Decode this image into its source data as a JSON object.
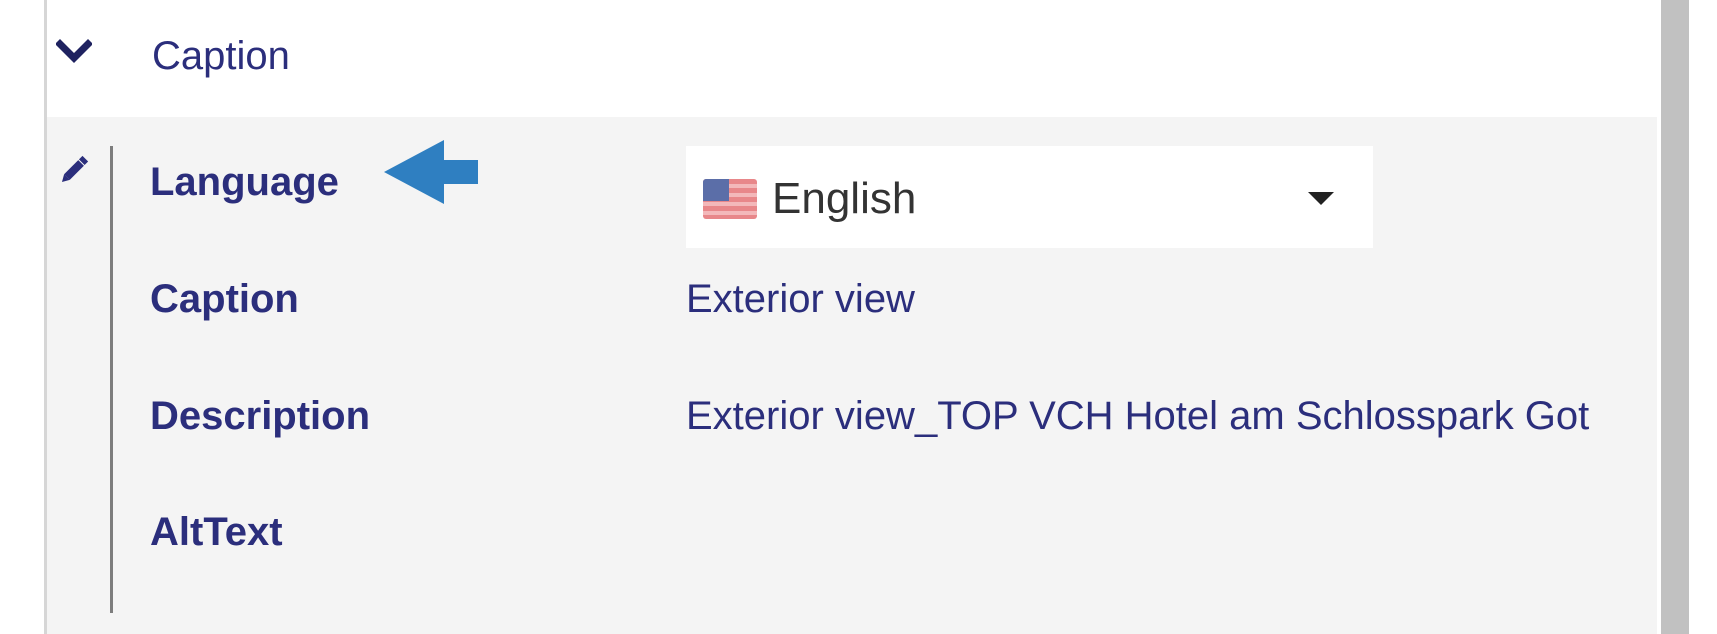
{
  "section": {
    "title": "Caption"
  },
  "fields": {
    "language_label": "Language",
    "caption_label": "Caption",
    "description_label": "Description",
    "alttext_label": "AltText"
  },
  "values": {
    "language": "English",
    "caption": "Exterior view",
    "description": "Exterior view_TOP VCH Hotel am Schlosspark Got",
    "alttext": ""
  },
  "icons": {
    "collapse": "chevron-down-icon",
    "edit": "pencil-icon",
    "flag": "us-flag-icon",
    "dropdown": "caret-down-icon",
    "pointer": "arrow-left-icon"
  },
  "colors": {
    "label": "#2b2e7c",
    "panel_bg": "#f4f4f4",
    "arrow": "#2f7fc1"
  }
}
